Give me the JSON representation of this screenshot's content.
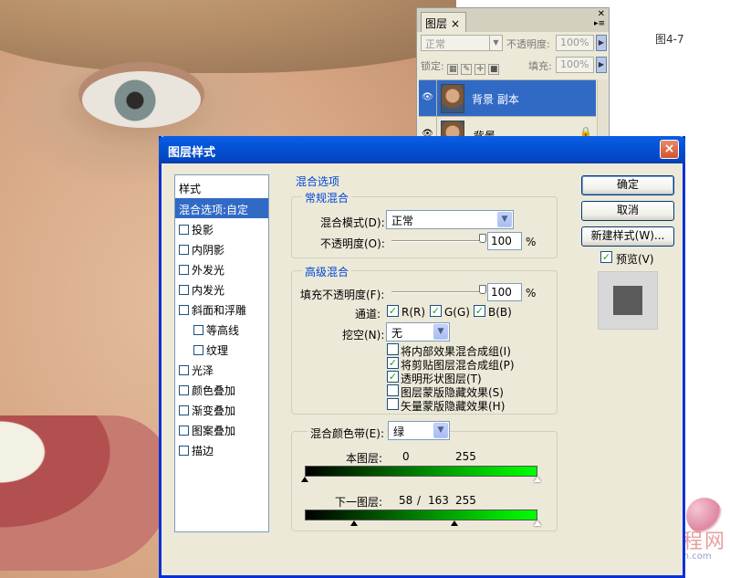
{
  "figure_label": "图4-7",
  "watermark": {
    "text": "中国教程网",
    "url": "www.jcwcn.com"
  },
  "layers_panel": {
    "tab": "图层",
    "close": "×",
    "blend_mode": "正常",
    "opacity_label": "不透明度:",
    "opacity_value": "100%",
    "lock_label": "锁定:",
    "fill_label": "填充:",
    "fill_value": "100%",
    "layers": [
      {
        "name": "背景 副本",
        "selected": true
      },
      {
        "name": "背景",
        "selected": false
      }
    ]
  },
  "dialog": {
    "title": "图层样式",
    "close": "×",
    "sidebar": {
      "header": "样式",
      "items": [
        {
          "label": "混合选项:自定",
          "active": true,
          "checkbox": false
        },
        {
          "label": "投影",
          "checkbox": true
        },
        {
          "label": "内阴影",
          "checkbox": true
        },
        {
          "label": "外发光",
          "checkbox": true
        },
        {
          "label": "内发光",
          "checkbox": true
        },
        {
          "label": "斜面和浮雕",
          "checkbox": true
        },
        {
          "label": "等高线",
          "checkbox": true,
          "indent": true
        },
        {
          "label": "纹理",
          "checkbox": true,
          "indent": true
        },
        {
          "label": "光泽",
          "checkbox": true
        },
        {
          "label": "颜色叠加",
          "checkbox": true
        },
        {
          "label": "渐变叠加",
          "checkbox": true
        },
        {
          "label": "图案叠加",
          "checkbox": true
        },
        {
          "label": "描边",
          "checkbox": true
        }
      ]
    },
    "blend_options": {
      "legend": "混合选项",
      "general": {
        "legend": "常规混合",
        "mode_label": "混合模式(D):",
        "mode_value": "正常",
        "opacity_label": "不透明度(O):",
        "opacity_value": "100",
        "opacity_unit": "%",
        "opacity_level": 100
      },
      "advanced": {
        "legend": "高级混合",
        "fill_label": "填充不透明度(F):",
        "fill_value": "100",
        "fill_unit": "%",
        "fill_level": 100,
        "channels_label": "通道:",
        "channels": [
          "R(R)",
          "G(G)",
          "B(B)"
        ],
        "knockout_label": "挖空(N):",
        "knockout_value": "无",
        "options": [
          {
            "label": "将内部效果混合成组(I)",
            "checked": false
          },
          {
            "label": "将剪贴图层混合成组(P)",
            "checked": true
          },
          {
            "label": "透明形状图层(T)",
            "checked": true
          },
          {
            "label": "图层蒙版隐藏效果(S)",
            "checked": false
          },
          {
            "label": "矢量蒙版隐藏效果(H)",
            "checked": false
          }
        ]
      },
      "blend_if": {
        "label": "混合颜色带(E):",
        "value": "绿",
        "this_layer_label": "本图层:",
        "this_layer_low": "0",
        "this_layer_high": "255",
        "underlying_label": "下一图层:",
        "underlying_low": "58",
        "underlying_sep": "/",
        "underlying_mid": "163",
        "underlying_high": "255"
      }
    },
    "buttons": {
      "ok": "确定",
      "cancel": "取消",
      "new_style": "新建样式(W)...",
      "preview": "预览(V)"
    }
  }
}
